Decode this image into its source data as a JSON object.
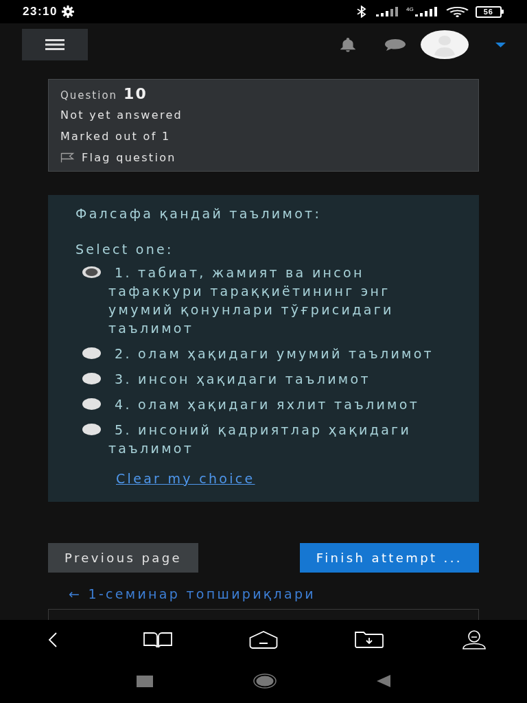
{
  "status_bar": {
    "time": "23:10",
    "network_type": "4G",
    "battery": "56"
  },
  "question_info": {
    "label": "Question",
    "number": "10",
    "state": "Not yet answered",
    "marks": "Marked out of 1",
    "flag": {
      "label": "Flag question",
      "flagged": false
    }
  },
  "question": {
    "text": "Фалсафа қандай таълимот:",
    "prompt": "Select one:",
    "options": [
      {
        "label": "1. табиат, жамият ва инсон тафаккури тараққиётининг энг умумий қонунлари тўғрисидаги таълимот",
        "selected": true
      },
      {
        "label": "2. олам ҳақидаги умумий таълимот",
        "selected": false
      },
      {
        "label": "3. инсон ҳақидаги таълимот",
        "selected": false
      },
      {
        "label": "4. олам ҳақидаги яхлит таълимот",
        "selected": false
      },
      {
        "label": "5. инсоний қадриятлар ҳақидаги таълимот",
        "selected": false
      }
    ],
    "clear_link": "Clear my choice"
  },
  "navigation": {
    "previous": "Previous page",
    "finish": "Finish attempt ...",
    "back_link": "← 1-семинар топшириқлари"
  }
}
